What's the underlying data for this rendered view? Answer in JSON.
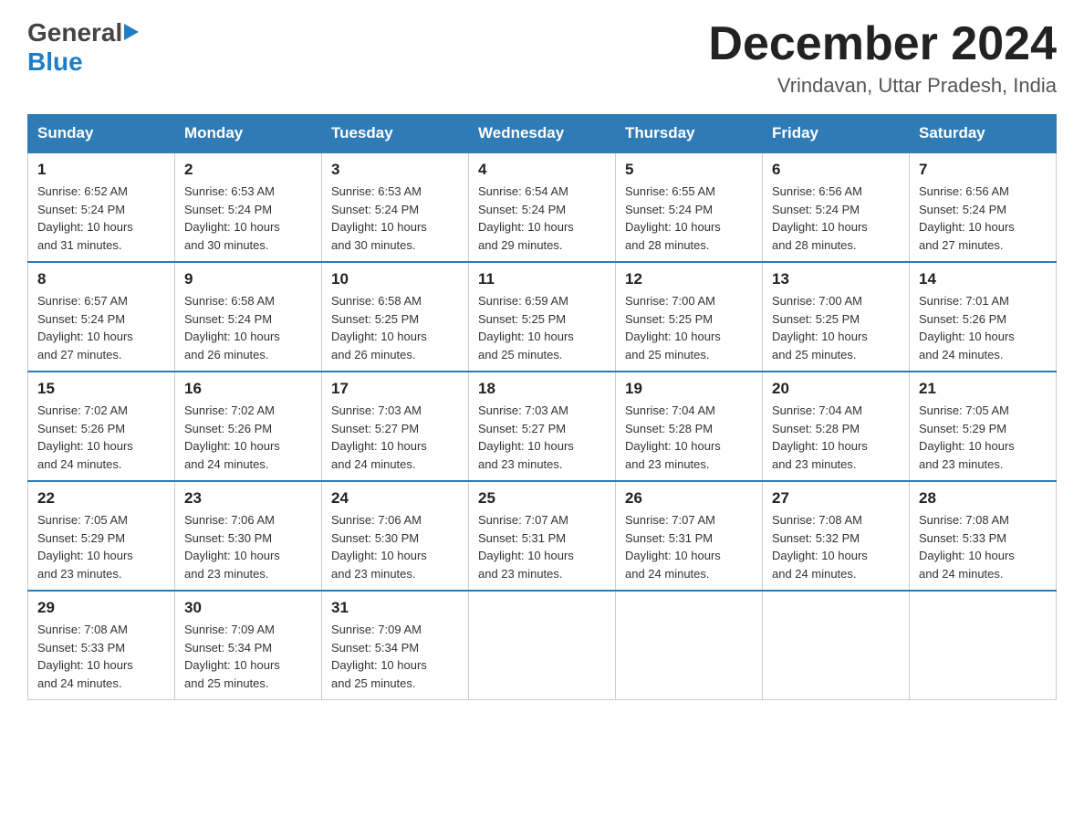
{
  "header": {
    "logo_general": "General",
    "logo_blue": "Blue",
    "month_title": "December 2024",
    "location": "Vrindavan, Uttar Pradesh, India"
  },
  "days_of_week": [
    "Sunday",
    "Monday",
    "Tuesday",
    "Wednesday",
    "Thursday",
    "Friday",
    "Saturday"
  ],
  "weeks": [
    [
      {
        "day": "1",
        "sunrise": "6:52 AM",
        "sunset": "5:24 PM",
        "daylight": "10 hours and 31 minutes."
      },
      {
        "day": "2",
        "sunrise": "6:53 AM",
        "sunset": "5:24 PM",
        "daylight": "10 hours and 30 minutes."
      },
      {
        "day": "3",
        "sunrise": "6:53 AM",
        "sunset": "5:24 PM",
        "daylight": "10 hours and 30 minutes."
      },
      {
        "day": "4",
        "sunrise": "6:54 AM",
        "sunset": "5:24 PM",
        "daylight": "10 hours and 29 minutes."
      },
      {
        "day": "5",
        "sunrise": "6:55 AM",
        "sunset": "5:24 PM",
        "daylight": "10 hours and 28 minutes."
      },
      {
        "day": "6",
        "sunrise": "6:56 AM",
        "sunset": "5:24 PM",
        "daylight": "10 hours and 28 minutes."
      },
      {
        "day": "7",
        "sunrise": "6:56 AM",
        "sunset": "5:24 PM",
        "daylight": "10 hours and 27 minutes."
      }
    ],
    [
      {
        "day": "8",
        "sunrise": "6:57 AM",
        "sunset": "5:24 PM",
        "daylight": "10 hours and 27 minutes."
      },
      {
        "day": "9",
        "sunrise": "6:58 AM",
        "sunset": "5:24 PM",
        "daylight": "10 hours and 26 minutes."
      },
      {
        "day": "10",
        "sunrise": "6:58 AM",
        "sunset": "5:25 PM",
        "daylight": "10 hours and 26 minutes."
      },
      {
        "day": "11",
        "sunrise": "6:59 AM",
        "sunset": "5:25 PM",
        "daylight": "10 hours and 25 minutes."
      },
      {
        "day": "12",
        "sunrise": "7:00 AM",
        "sunset": "5:25 PM",
        "daylight": "10 hours and 25 minutes."
      },
      {
        "day": "13",
        "sunrise": "7:00 AM",
        "sunset": "5:25 PM",
        "daylight": "10 hours and 25 minutes."
      },
      {
        "day": "14",
        "sunrise": "7:01 AM",
        "sunset": "5:26 PM",
        "daylight": "10 hours and 24 minutes."
      }
    ],
    [
      {
        "day": "15",
        "sunrise": "7:02 AM",
        "sunset": "5:26 PM",
        "daylight": "10 hours and 24 minutes."
      },
      {
        "day": "16",
        "sunrise": "7:02 AM",
        "sunset": "5:26 PM",
        "daylight": "10 hours and 24 minutes."
      },
      {
        "day": "17",
        "sunrise": "7:03 AM",
        "sunset": "5:27 PM",
        "daylight": "10 hours and 24 minutes."
      },
      {
        "day": "18",
        "sunrise": "7:03 AM",
        "sunset": "5:27 PM",
        "daylight": "10 hours and 23 minutes."
      },
      {
        "day": "19",
        "sunrise": "7:04 AM",
        "sunset": "5:28 PM",
        "daylight": "10 hours and 23 minutes."
      },
      {
        "day": "20",
        "sunrise": "7:04 AM",
        "sunset": "5:28 PM",
        "daylight": "10 hours and 23 minutes."
      },
      {
        "day": "21",
        "sunrise": "7:05 AM",
        "sunset": "5:29 PM",
        "daylight": "10 hours and 23 minutes."
      }
    ],
    [
      {
        "day": "22",
        "sunrise": "7:05 AM",
        "sunset": "5:29 PM",
        "daylight": "10 hours and 23 minutes."
      },
      {
        "day": "23",
        "sunrise": "7:06 AM",
        "sunset": "5:30 PM",
        "daylight": "10 hours and 23 minutes."
      },
      {
        "day": "24",
        "sunrise": "7:06 AM",
        "sunset": "5:30 PM",
        "daylight": "10 hours and 23 minutes."
      },
      {
        "day": "25",
        "sunrise": "7:07 AM",
        "sunset": "5:31 PM",
        "daylight": "10 hours and 23 minutes."
      },
      {
        "day": "26",
        "sunrise": "7:07 AM",
        "sunset": "5:31 PM",
        "daylight": "10 hours and 24 minutes."
      },
      {
        "day": "27",
        "sunrise": "7:08 AM",
        "sunset": "5:32 PM",
        "daylight": "10 hours and 24 minutes."
      },
      {
        "day": "28",
        "sunrise": "7:08 AM",
        "sunset": "5:33 PM",
        "daylight": "10 hours and 24 minutes."
      }
    ],
    [
      {
        "day": "29",
        "sunrise": "7:08 AM",
        "sunset": "5:33 PM",
        "daylight": "10 hours and 24 minutes."
      },
      {
        "day": "30",
        "sunrise": "7:09 AM",
        "sunset": "5:34 PM",
        "daylight": "10 hours and 25 minutes."
      },
      {
        "day": "31",
        "sunrise": "7:09 AM",
        "sunset": "5:34 PM",
        "daylight": "10 hours and 25 minutes."
      },
      null,
      null,
      null,
      null
    ]
  ],
  "labels": {
    "sunrise": "Sunrise:",
    "sunset": "Sunset:",
    "daylight": "Daylight:"
  }
}
